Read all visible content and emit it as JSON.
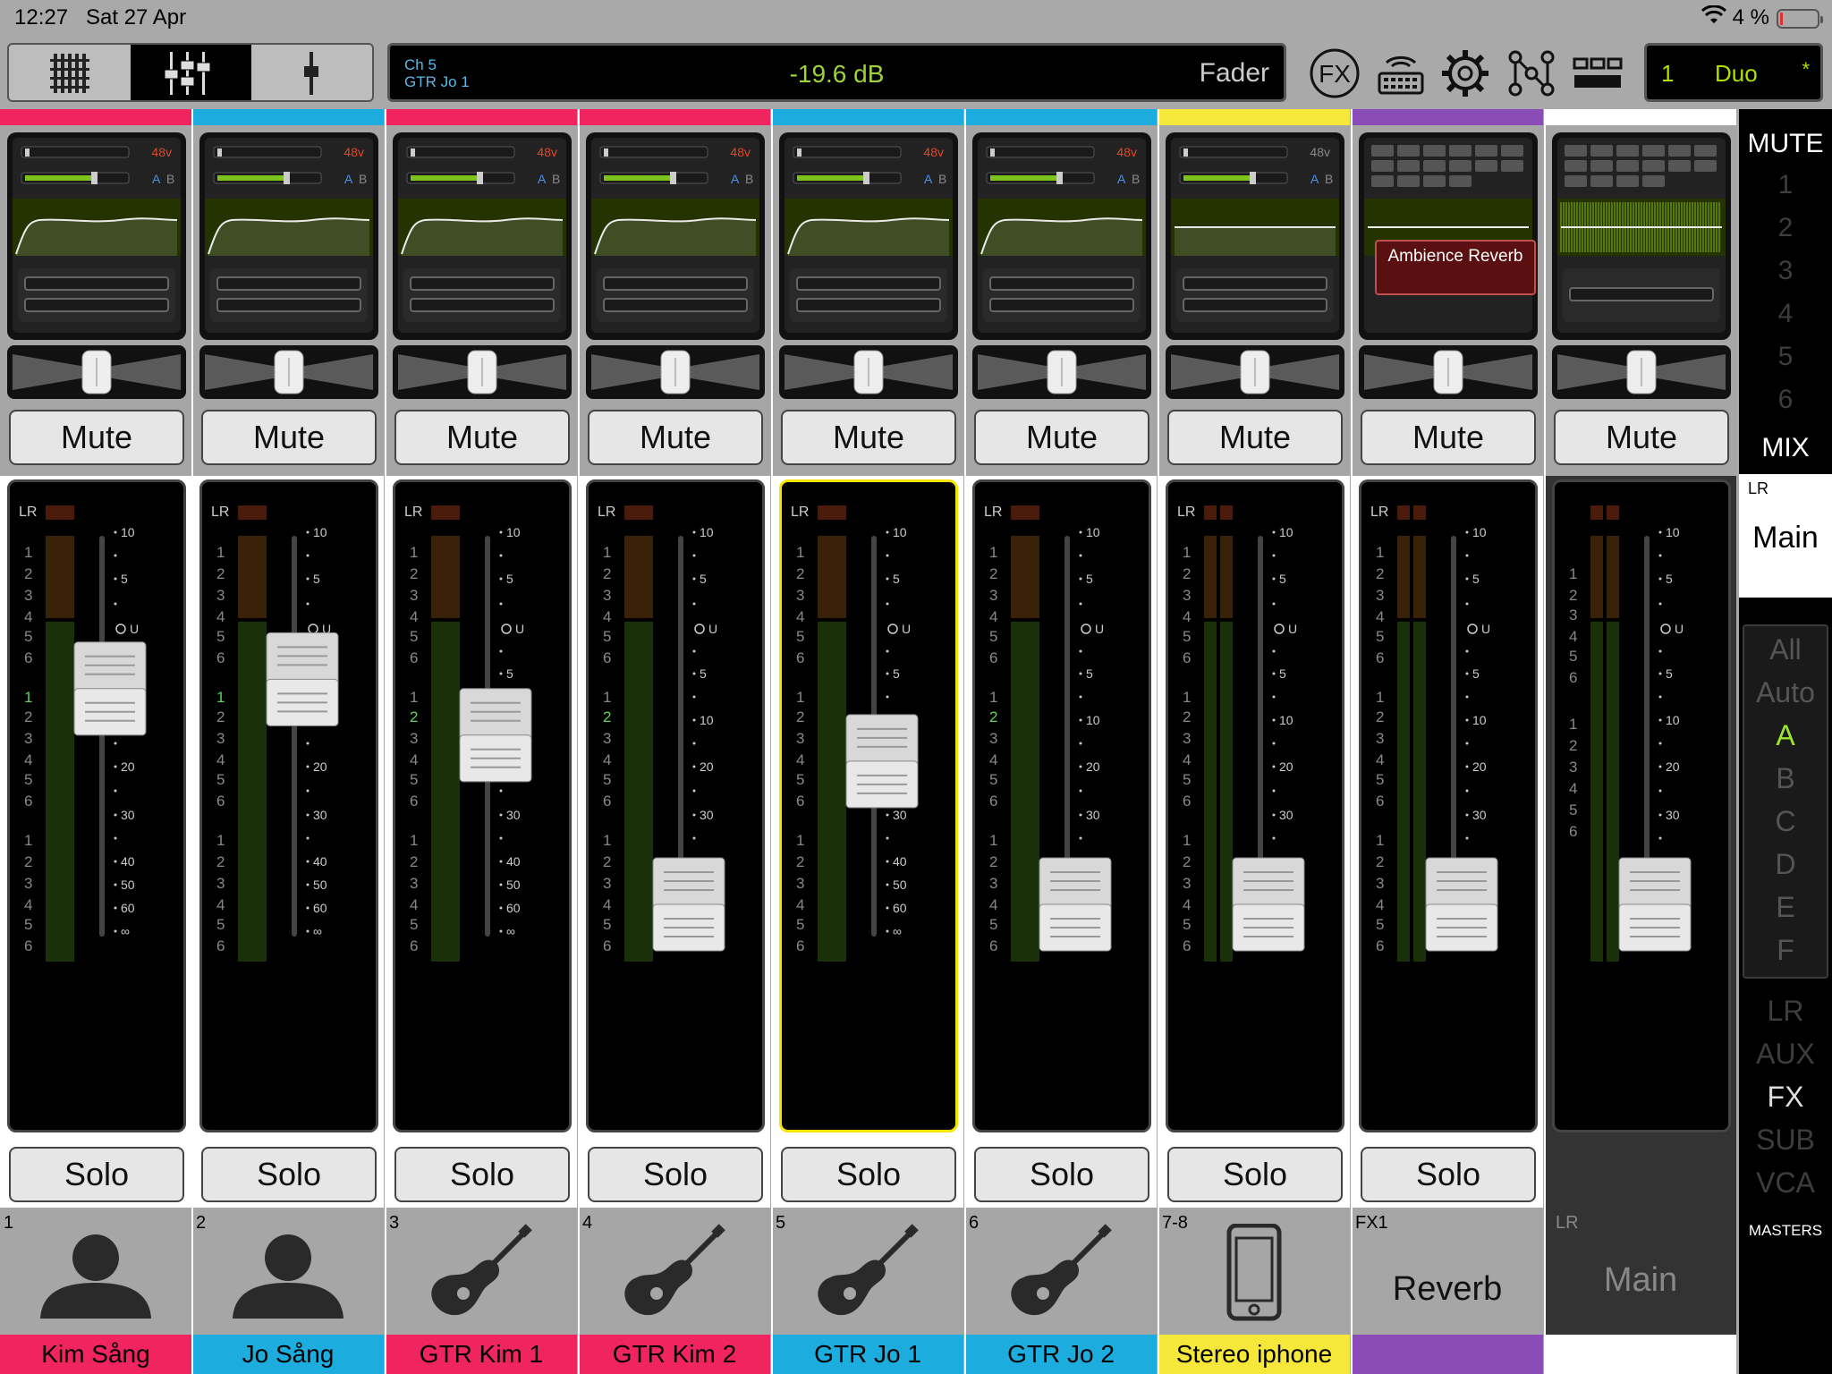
{
  "status": {
    "time": "12:27",
    "date": "Sat 27 Apr",
    "battery": "4 %"
  },
  "toolbar": {
    "channel_number": "Ch 5",
    "channel_name": "GTR Jo 1",
    "level": "-19.6 dB",
    "mode": "Fader",
    "fx_label": "FX",
    "preset_number": "1",
    "preset_name": "Duo",
    "preset_modified": "*"
  },
  "common": {
    "mute_label": "Mute",
    "solo_label": "Solo",
    "phantom_label": "48v",
    "a_label": "A",
    "b_label": "B",
    "lr_label": "LR",
    "scale_labels": [
      "10",
      "5",
      "U",
      "5",
      "10",
      "20",
      "30",
      "40",
      "50",
      "60",
      "∞"
    ],
    "meter_numbers": [
      "1",
      "2",
      "3",
      "4",
      "5",
      "6"
    ]
  },
  "strips": [
    {
      "number": "1",
      "name": "Kim Sång",
      "color": "#f0245e",
      "icon": "person-icon",
      "fader_db": -7,
      "phantom_on": true,
      "selected": false
    },
    {
      "number": "2",
      "name": "Jo Sång",
      "color": "#1cacde",
      "icon": "person-icon",
      "fader_db": -6,
      "phantom_on": true,
      "selected": false
    },
    {
      "number": "3",
      "name": "GTR Kim 1",
      "color": "#f0245e",
      "icon": "guitar-icon",
      "fader_db": -14,
      "phantom_on": true,
      "selected": false
    },
    {
      "number": "4",
      "name": "GTR Kim 2",
      "color": "#f0245e",
      "icon": "guitar-icon",
      "fader_db": -60,
      "phantom_on": true,
      "selected": false
    },
    {
      "number": "5",
      "name": "GTR Jo 1",
      "color": "#1cacde",
      "icon": "guitar-icon",
      "fader_db": -19.6,
      "phantom_on": true,
      "selected": true
    },
    {
      "number": "6",
      "name": "GTR Jo 2",
      "color": "#1cacde",
      "icon": "guitar-icon",
      "fader_db": -60,
      "phantom_on": true,
      "selected": false
    },
    {
      "number": "7-8",
      "name": "Stereo iphone",
      "color": "#f5e83a",
      "icon": "phone-icon",
      "fader_db": -60,
      "phantom_on": false,
      "selected": false
    },
    {
      "number": "FX1",
      "name": "",
      "color": "#8a4cb6",
      "icon": "",
      "fx_name": "Reverb",
      "fx_preset": "Ambience Reverb",
      "fader_db": -60,
      "selected": false
    },
    {
      "number": "LR",
      "name": "",
      "color": "#ffffff",
      "icon": "",
      "master_name": "Main",
      "fader_db": -60,
      "selected": false
    }
  ],
  "sidebar": {
    "mute_title": "MUTE",
    "mute_groups": [
      "1",
      "2",
      "3",
      "4",
      "5",
      "6"
    ],
    "mix_title": "MIX",
    "mix_lr": "LR",
    "mix_main": "Main",
    "views": [
      "All",
      "Auto",
      "A",
      "B",
      "C",
      "D",
      "E",
      "F"
    ],
    "active_view": "A",
    "masters": [
      "LR",
      "AUX",
      "FX",
      "SUB",
      "VCA"
    ],
    "active_master": "FX",
    "masters_title": "MASTERS"
  }
}
